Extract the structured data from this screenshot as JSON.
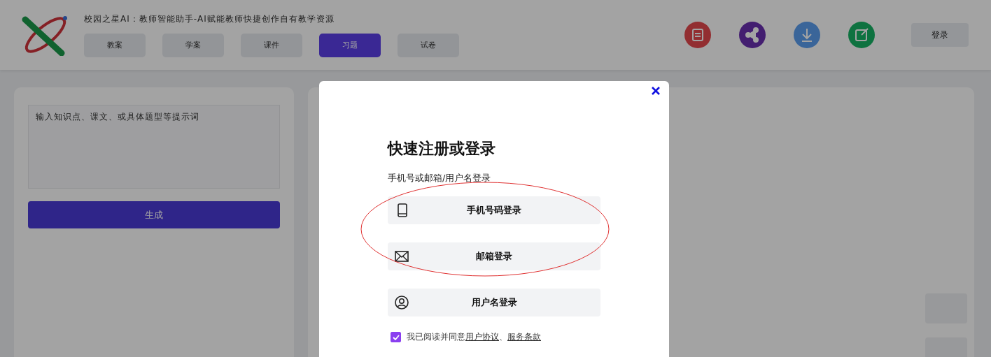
{
  "header": {
    "title": "校园之星AI：教师智能助手-AI赋能教师快捷创作自有教学资源",
    "tabs": [
      {
        "label": "教案",
        "selected": false
      },
      {
        "label": "学案",
        "selected": false
      },
      {
        "label": "课件",
        "selected": false
      },
      {
        "label": "习题",
        "selected": true
      },
      {
        "label": "试卷",
        "selected": false
      }
    ],
    "login_button": "登录"
  },
  "left_panel": {
    "placeholder": "输入知识点、课文、或具体题型等提示词",
    "generate_button": "生成"
  },
  "modal": {
    "title": "快速注册或登录",
    "subtitle": "手机号或邮箱/用户名登录",
    "options": [
      {
        "kind": "phone",
        "label": "手机号码登录"
      },
      {
        "kind": "email",
        "label": "邮箱登录"
      },
      {
        "kind": "user",
        "label": "用户名登录"
      }
    ],
    "agreement": {
      "checked": true,
      "text": "我已阅读并同意",
      "links": [
        "用户协议",
        "服务条款"
      ],
      "separator": "、"
    }
  }
}
